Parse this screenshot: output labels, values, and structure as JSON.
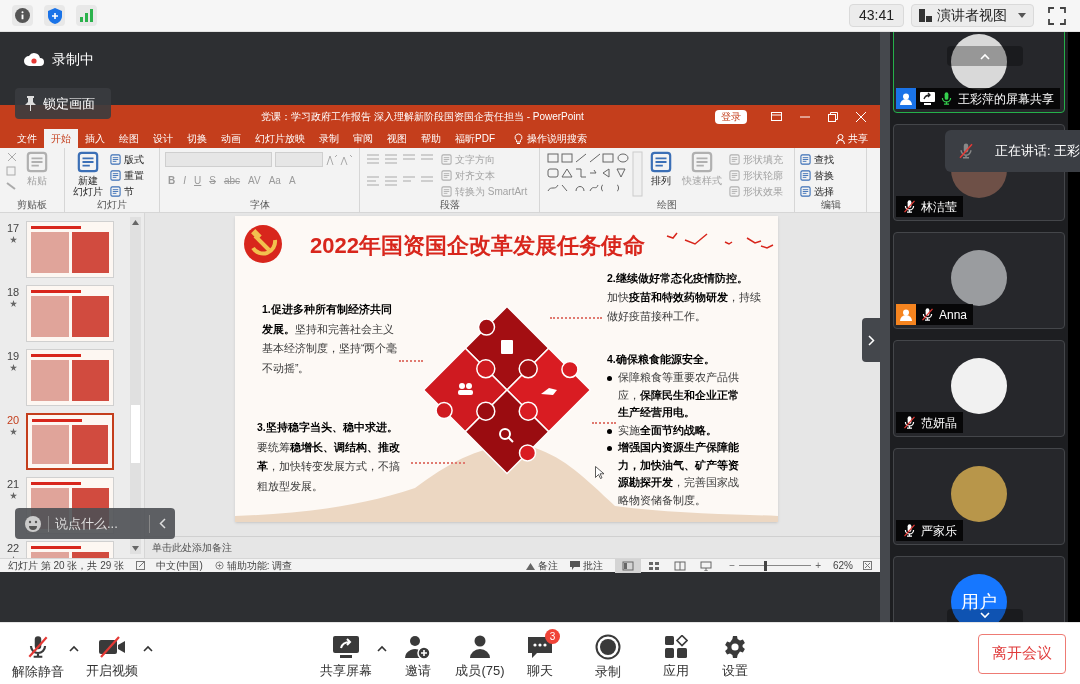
{
  "top_bar": {
    "timer": "43:41",
    "view_menu": {
      "label": "演讲者视图"
    }
  },
  "recording": {
    "label": "录制中"
  },
  "lock_screen": {
    "label": "锁定画面"
  },
  "powerpoint": {
    "title": "党课：学习政府工作报告 深入理解新阶段国资国企责任担当 - PowerPoint",
    "login_button": "登录",
    "tabs": [
      {
        "label": "文件",
        "selected": false
      },
      {
        "label": "开始",
        "selected": true
      },
      {
        "label": "插入",
        "selected": false
      },
      {
        "label": "绘图",
        "selected": false
      },
      {
        "label": "设计",
        "selected": false
      },
      {
        "label": "切换",
        "selected": false
      },
      {
        "label": "动画",
        "selected": false
      },
      {
        "label": "幻灯片放映",
        "selected": false
      },
      {
        "label": "录制",
        "selected": false
      },
      {
        "label": "审阅",
        "selected": false
      },
      {
        "label": "视图",
        "selected": false
      },
      {
        "label": "帮助",
        "selected": false
      },
      {
        "label": "福昕PDF",
        "selected": false
      }
    ],
    "search_hint": "操作说明搜索",
    "share_button": "共享",
    "ribbon_groups": [
      {
        "name": "剪贴板",
        "kind": "clipboard",
        "items": [
          {
            "label": "粘贴",
            "kind": "large",
            "disabled": true
          }
        ]
      },
      {
        "name": "幻灯片",
        "kind": "slides",
        "items": [
          {
            "lines": [
              "新建",
              "幻灯片"
            ],
            "kind": "large",
            "disabled": false
          },
          {
            "label": "版式",
            "kind": "small",
            "disabled": false
          },
          {
            "label": "重置",
            "kind": "small",
            "disabled": false
          },
          {
            "label": "节",
            "kind": "small",
            "disabled": false
          }
        ]
      },
      {
        "name": "字体",
        "kind": "font",
        "items": [
          {
            "label": "B",
            "kind": "glyph",
            "disabled": true
          },
          {
            "label": "I",
            "kind": "glyph",
            "disabled": true
          },
          {
            "label": "U",
            "kind": "glyph",
            "disabled": true
          },
          {
            "label": "S",
            "kind": "glyph",
            "disabled": true
          },
          {
            "label": "abc",
            "kind": "glyph",
            "disabled": true
          },
          {
            "label": "AV",
            "kind": "glyph",
            "disabled": true
          },
          {
            "label": "Aa",
            "kind": "glyph",
            "disabled": true
          },
          {
            "label": "A",
            "kind": "glyph",
            "disabled": true
          }
        ]
      },
      {
        "name": "段落",
        "kind": "paragraph",
        "items": [
          {
            "label": "文字方向",
            "kind": "small",
            "disabled": true
          },
          {
            "label": "对齐文本",
            "kind": "small",
            "disabled": true
          },
          {
            "label": "转换为 SmartArt",
            "kind": "small",
            "disabled": true
          }
        ]
      },
      {
        "name": "绘图",
        "kind": "drawing",
        "items": [
          {
            "label": "排列",
            "kind": "large",
            "disabled": false
          },
          {
            "label": "快速样式",
            "kind": "large",
            "disabled": true
          },
          {
            "label": "形状填充",
            "kind": "small",
            "disabled": true
          },
          {
            "label": "形状轮廓",
            "kind": "small",
            "disabled": true
          },
          {
            "label": "形状效果",
            "kind": "small",
            "disabled": true
          }
        ]
      },
      {
        "name": "编辑",
        "kind": "editing",
        "items": [
          {
            "label": "查找",
            "kind": "small",
            "disabled": false
          },
          {
            "label": "替换",
            "kind": "small",
            "disabled": false
          },
          {
            "label": "选择",
            "kind": "small",
            "disabled": false
          }
        ]
      }
    ],
    "thumbnails": [
      {
        "number": "17",
        "selected": false
      },
      {
        "number": "18",
        "selected": false
      },
      {
        "number": "19",
        "selected": false
      },
      {
        "number": "20",
        "selected": true
      },
      {
        "number": "21",
        "selected": false
      },
      {
        "number": "22",
        "selected": false
      }
    ],
    "slide": {
      "title": "2022年国资国企改革发展任务使命",
      "points": [
        {
          "kind": "paragraph",
          "text": "**1.促进多种所有制经济共同发展。**坚持和完善社会主义基本经济制度，坚持“两个毫不动摇”。"
        },
        {
          "kind": "block",
          "heading": "2.继续做好常态化疫情防控。",
          "body": "加快**疫苗和特效药物研发**，持续做好疫苗接种工作。"
        },
        {
          "kind": "paragraph",
          "text": "**3.坚持稳字当头、稳中求进。**要统筹**稳增长、调结构、推改革**，加快转变发展方式，不搞粗放型发展。"
        },
        {
          "kind": "list",
          "heading": "4.确保粮食能源安全。",
          "bullets": [
            "保障粮食等重要农产品供应，**保障民生和企业正常生产经营用电。**",
            "实施**全面节约战略。**",
            "**增强国内资源生产保障能力，加快油气、矿产等资源勘探开发**，完善国家战略物资储备制度。"
          ]
        }
      ]
    },
    "notes_placeholder": "单击此处添加备注",
    "status_bar": {
      "slide_info": "幻灯片 第 20 张，共 29 张",
      "language": "中文(中国)",
      "accessibility": "辅助功能: 调查",
      "notes_button": "备注",
      "comments_button": "批注",
      "views": [
        {
          "kind": "normal",
          "selected": true
        },
        {
          "kind": "sorter",
          "selected": false
        },
        {
          "kind": "reading",
          "selected": false
        },
        {
          "kind": "slideshow",
          "selected": false
        }
      ],
      "zoom_out": "−",
      "zoom": {
        "level": 0.36
      },
      "zoom_in": "+",
      "zoom_text": "62%"
    }
  },
  "chat_input": {
    "placeholder": "说点什么..."
  },
  "participants": [
    {
      "name": "王彩萍的屏幕共享",
      "active": true,
      "muted": false,
      "sharing": true,
      "badge": {
        "color": "#1a73e8"
      }
    },
    {
      "name": "林洁莹",
      "active": false,
      "muted": true,
      "sharing": false
    },
    {
      "name": "Anna",
      "active": false,
      "muted": true,
      "sharing": false,
      "badge": {
        "color": "#f5841f"
      }
    },
    {
      "name": "范妍晶",
      "active": false,
      "muted": true,
      "sharing": false
    },
    {
      "name": "严家乐",
      "active": false,
      "muted": true,
      "sharing": false
    },
    {
      "avatar_text": "用户",
      "active": false
    }
  ],
  "speaking_tooltip": {
    "text": "正在讲话: 王彩"
  },
  "toolbar": {
    "items": [
      {
        "label": "解除静音",
        "kind": "mic",
        "muted": true,
        "menu": true
      },
      {
        "label": "开启视频",
        "kind": "video",
        "on": false,
        "menu": true
      },
      {
        "label": "共享屏幕",
        "kind": "share",
        "menu": true
      },
      {
        "label": "邀请",
        "kind": "invite",
        "menu": false
      },
      {
        "label": "成员(75)",
        "kind": "members",
        "menu": false
      },
      {
        "label": "聊天",
        "kind": "chat",
        "badge": "3",
        "menu": false
      },
      {
        "label": "录制",
        "kind": "record",
        "menu": false
      },
      {
        "label": "应用",
        "kind": "apps",
        "menu": false
      },
      {
        "label": "设置",
        "kind": "settings",
        "menu": false
      }
    ]
  },
  "leave_button": "离开会议"
}
